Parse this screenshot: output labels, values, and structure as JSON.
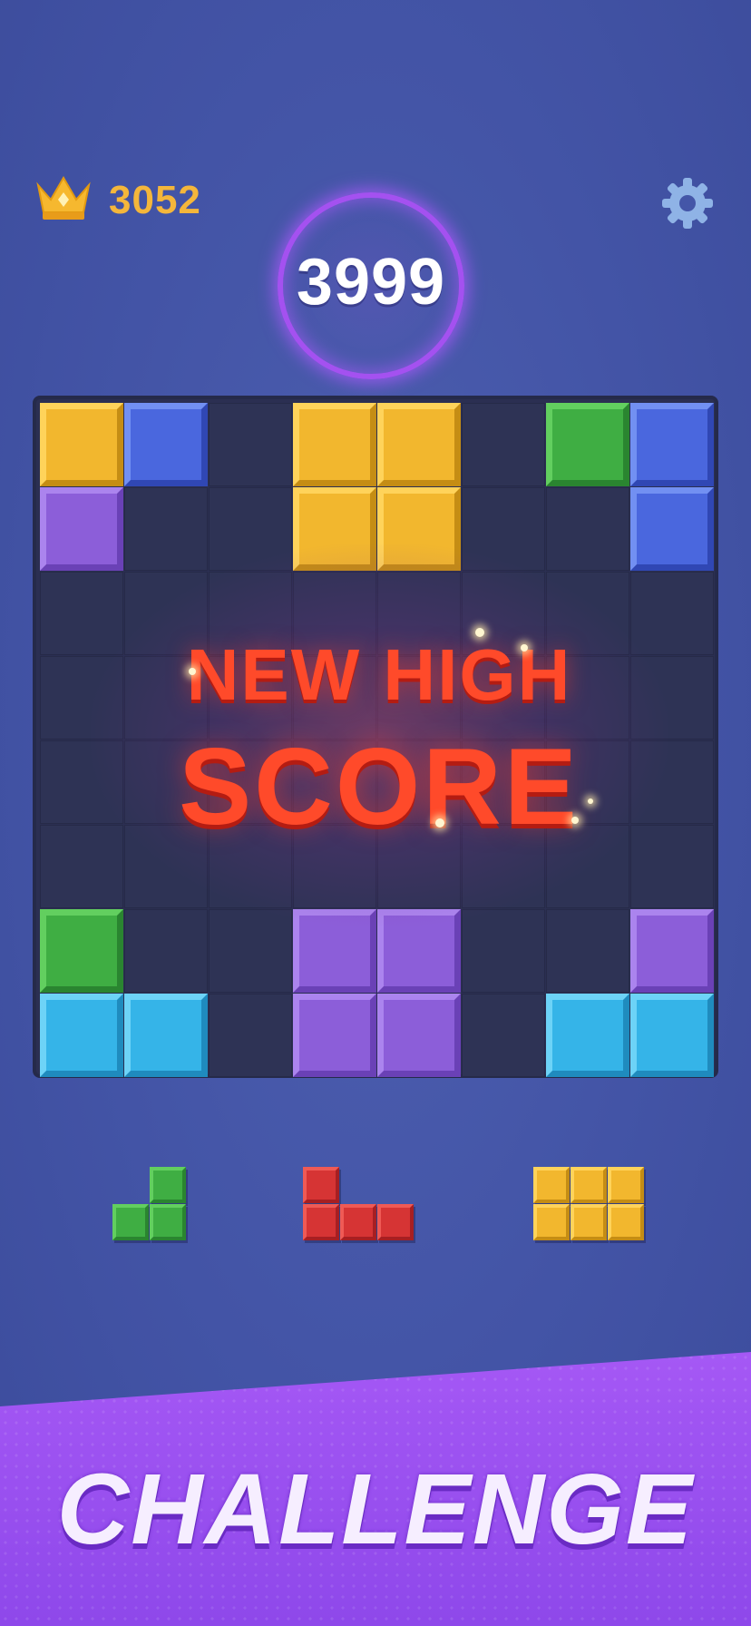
{
  "hud": {
    "best_score": "3052",
    "current_score": "3999",
    "crown_icon": "crown-icon",
    "settings_icon": "gear-icon"
  },
  "board": {
    "columns": 8,
    "rows": 8,
    "cells": [
      [
        {
          "c": 0,
          "color": "yellow"
        },
        {
          "c": 1,
          "color": "blue"
        },
        {
          "c": 3,
          "color": "yellow"
        },
        {
          "c": 4,
          "color": "yellow"
        },
        {
          "c": 6,
          "color": "green"
        },
        {
          "c": 7,
          "color": "blue"
        }
      ],
      [
        {
          "c": 0,
          "color": "purple"
        },
        {
          "c": 3,
          "color": "yellow"
        },
        {
          "c": 4,
          "color": "yellow"
        },
        {
          "c": 7,
          "color": "blue"
        }
      ],
      [],
      [],
      [],
      [],
      [
        {
          "c": 0,
          "color": "green"
        },
        {
          "c": 3,
          "color": "purple"
        },
        {
          "c": 4,
          "color": "purple"
        },
        {
          "c": 7,
          "color": "purple"
        }
      ],
      [
        {
          "c": 0,
          "color": "cyan"
        },
        {
          "c": 1,
          "color": "cyan"
        },
        {
          "c": 3,
          "color": "purple"
        },
        {
          "c": 4,
          "color": "purple"
        },
        {
          "c": 6,
          "color": "cyan"
        },
        {
          "c": 7,
          "color": "cyan"
        }
      ]
    ]
  },
  "banner": {
    "line1": "NEW HIGH",
    "line2": "SCORE"
  },
  "pieces": [
    {
      "name": "green-piece",
      "color": "green",
      "blocks": [
        [
          1,
          0
        ],
        [
          0,
          1
        ],
        [
          1,
          1
        ]
      ]
    },
    {
      "name": "red-piece",
      "color": "red",
      "blocks": [
        [
          0,
          0
        ],
        [
          0,
          1
        ],
        [
          1,
          1
        ],
        [
          2,
          1
        ]
      ]
    },
    {
      "name": "yellow-piece",
      "color": "yellow",
      "blocks": [
        [
          0,
          0
        ],
        [
          1,
          0
        ],
        [
          2,
          0
        ],
        [
          0,
          1
        ],
        [
          1,
          1
        ],
        [
          2,
          1
        ]
      ]
    }
  ],
  "colors": {
    "yellow": {
      "base": "#f2b72e",
      "light": "#ffd35a",
      "dark": "#c58d14"
    },
    "blue": {
      "base": "#4a67de",
      "light": "#7290f2",
      "dark": "#3047b4"
    },
    "green": {
      "base": "#3fae43",
      "light": "#62cf5f",
      "dark": "#2a8530"
    },
    "purple": {
      "base": "#8c5ed9",
      "light": "#ab84ee",
      "dark": "#6a41b6"
    },
    "cyan": {
      "base": "#35b4e8",
      "light": "#6dd3f7",
      "dark": "#1f8bbe"
    },
    "red": {
      "base": "#d63434",
      "light": "#ef5a55",
      "dark": "#a71f22"
    }
  },
  "footer": {
    "title": "CHALLENGE"
  }
}
